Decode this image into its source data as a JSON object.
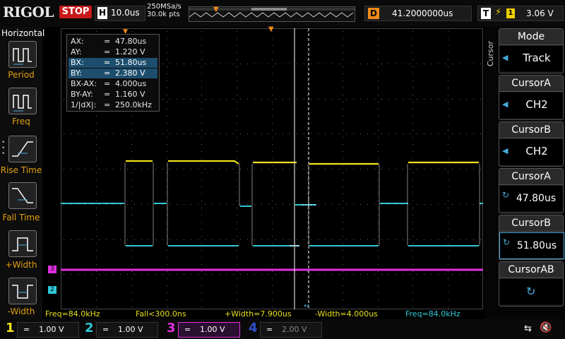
{
  "header": {
    "logo": "RIGOL",
    "run_state": "STOP",
    "timebase_label": "H",
    "timebase": "10.0us",
    "sample_rate": "250MSa/s",
    "points": "30.0k pts",
    "delay_label": "D",
    "delay": "41.2000000us",
    "trigger_label": "T",
    "trigger_channel": "1",
    "trigger_level": "3.06 V"
  },
  "left_menu": {
    "title": "Horizontal",
    "items": [
      {
        "label": "Period",
        "icon": "period-icon"
      },
      {
        "label": "Freq",
        "icon": "freq-icon"
      },
      {
        "label": "Rise Time",
        "icon": "rise-time-icon"
      },
      {
        "label": "Fall Time",
        "icon": "fall-time-icon"
      },
      {
        "label": "+Width",
        "icon": "positive-width-icon"
      },
      {
        "label": "-Width",
        "icon": "negative-width-icon"
      }
    ]
  },
  "cursor_info": {
    "rows": [
      {
        "name": "AX:",
        "eq": "=",
        "value": "47.80us",
        "selected": false
      },
      {
        "name": "AY:",
        "eq": "=",
        "value": "1.220 V",
        "selected": false
      },
      {
        "name": "BX:",
        "eq": "=",
        "value": "51.80us",
        "selected": true
      },
      {
        "name": "BY:",
        "eq": "=",
        "value": "2.380 V",
        "selected": true
      },
      {
        "name": "BX-AX:",
        "eq": "=",
        "value": "4.000us",
        "selected": false
      },
      {
        "name": "BY-AY:",
        "eq": "=",
        "value": "1.160 V",
        "selected": false
      },
      {
        "name": "1/|dX|:",
        "eq": "=",
        "value": "250.0kHz",
        "selected": false
      }
    ]
  },
  "measurements": [
    {
      "text": "Freq=84.0kHz",
      "color": "#e8e020"
    },
    {
      "text": "Fall<300.0ns",
      "color": "#e8e020"
    },
    {
      "text": "+Width=7.900us",
      "color": "#e8e020"
    },
    {
      "text": "-Width=4.000us",
      "color": "#e8e020"
    },
    {
      "text": "Freq=84.0kHz",
      "color": "#30c8d8"
    }
  ],
  "channels": [
    {
      "num": "1",
      "coupling": "=",
      "scale": "1.00 V",
      "color": "#f0e020",
      "active": false
    },
    {
      "num": "2",
      "coupling": "=",
      "scale": "1.00 V",
      "color": "#30c8d8",
      "active": false
    },
    {
      "num": "3",
      "coupling": "=",
      "scale": "1.00 V",
      "color": "#e030e0",
      "active": true
    },
    {
      "num": "4",
      "coupling": "=",
      "scale": "2.00 V",
      "color": "#3050d0",
      "active": false
    }
  ],
  "right_menu": {
    "vertical_title": "Cursor",
    "items": [
      {
        "header": "Mode",
        "value": "Track",
        "kind": "select"
      },
      {
        "header": "CursorA",
        "value": "CH2",
        "kind": "select"
      },
      {
        "header": "CursorB",
        "value": "CH2",
        "kind": "select"
      },
      {
        "header": "CursorA",
        "value": "47.80us",
        "kind": "knob"
      },
      {
        "header": "CursorB",
        "value": "51.80us",
        "kind": "knob"
      },
      {
        "header": "CursorAB",
        "value": "",
        "kind": "knob"
      }
    ]
  },
  "channel_markers": {
    "ch3": "3",
    "ch2": "2"
  },
  "colors": {
    "ch1": "#f0e020",
    "ch2": "#30c8d8",
    "ch3": "#e030e0",
    "trigger": "#f08a1a",
    "accent": "#4aa8d8"
  }
}
